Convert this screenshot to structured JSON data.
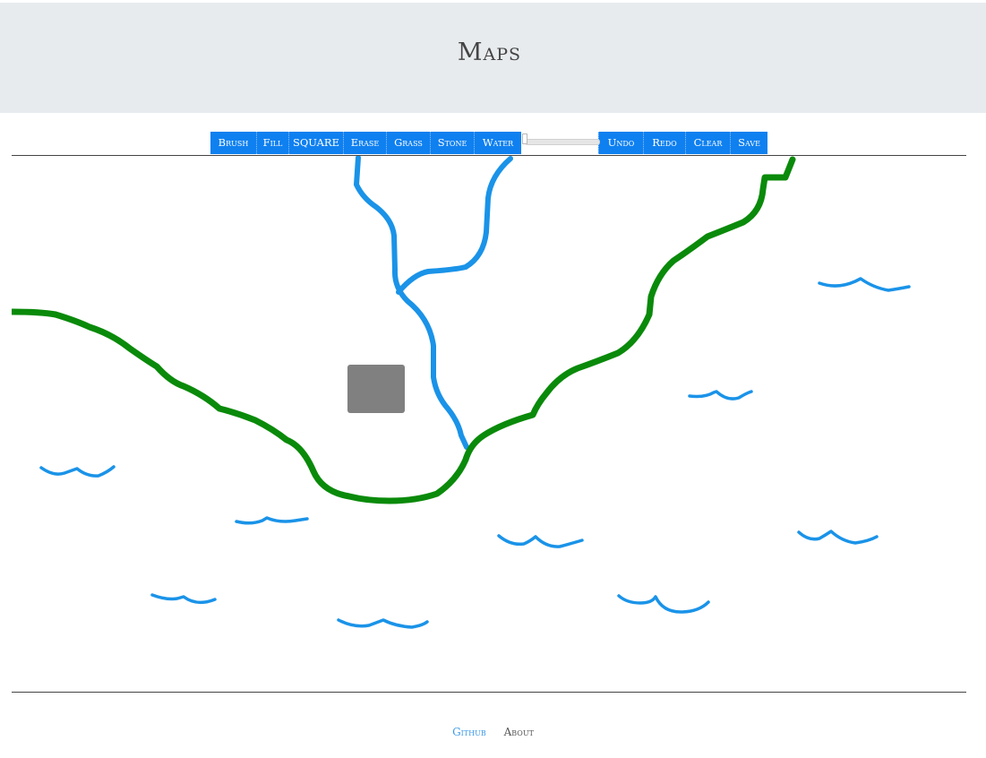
{
  "header": {
    "title": "Maps"
  },
  "toolbar": {
    "tools": [
      "Brush",
      "Fill",
      "SQUARE",
      "Erase",
      "Grass",
      "Stone",
      "Water"
    ],
    "actions": [
      "Undo",
      "Redo",
      "Clear",
      "Save"
    ]
  },
  "canvas": {
    "colors": {
      "water": "#1a93e8",
      "grass": "#0a8a0a",
      "stone": "#808080"
    }
  },
  "footer": {
    "links": [
      "Github",
      "About"
    ],
    "colors": {
      "github": "#3d9be9",
      "about": "#555555"
    }
  },
  "theme": {
    "header_bg": "#e8ebee",
    "toolbar_bg": "#0f80f0"
  }
}
